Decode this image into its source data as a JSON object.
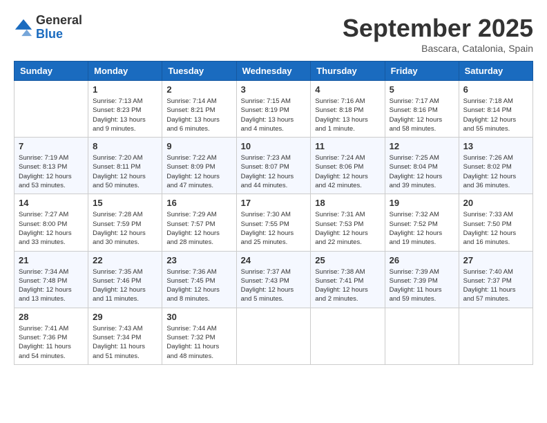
{
  "logo": {
    "general": "General",
    "blue": "Blue"
  },
  "title": "September 2025",
  "subtitle": "Bascara, Catalonia, Spain",
  "days_of_week": [
    "Sunday",
    "Monday",
    "Tuesday",
    "Wednesday",
    "Thursday",
    "Friday",
    "Saturday"
  ],
  "weeks": [
    [
      {
        "day": "",
        "info": ""
      },
      {
        "day": "1",
        "info": "Sunrise: 7:13 AM\nSunset: 8:23 PM\nDaylight: 13 hours\nand 9 minutes."
      },
      {
        "day": "2",
        "info": "Sunrise: 7:14 AM\nSunset: 8:21 PM\nDaylight: 13 hours\nand 6 minutes."
      },
      {
        "day": "3",
        "info": "Sunrise: 7:15 AM\nSunset: 8:19 PM\nDaylight: 13 hours\nand 4 minutes."
      },
      {
        "day": "4",
        "info": "Sunrise: 7:16 AM\nSunset: 8:18 PM\nDaylight: 13 hours\nand 1 minute."
      },
      {
        "day": "5",
        "info": "Sunrise: 7:17 AM\nSunset: 8:16 PM\nDaylight: 12 hours\nand 58 minutes."
      },
      {
        "day": "6",
        "info": "Sunrise: 7:18 AM\nSunset: 8:14 PM\nDaylight: 12 hours\nand 55 minutes."
      }
    ],
    [
      {
        "day": "7",
        "info": "Sunrise: 7:19 AM\nSunset: 8:13 PM\nDaylight: 12 hours\nand 53 minutes."
      },
      {
        "day": "8",
        "info": "Sunrise: 7:20 AM\nSunset: 8:11 PM\nDaylight: 12 hours\nand 50 minutes."
      },
      {
        "day": "9",
        "info": "Sunrise: 7:22 AM\nSunset: 8:09 PM\nDaylight: 12 hours\nand 47 minutes."
      },
      {
        "day": "10",
        "info": "Sunrise: 7:23 AM\nSunset: 8:07 PM\nDaylight: 12 hours\nand 44 minutes."
      },
      {
        "day": "11",
        "info": "Sunrise: 7:24 AM\nSunset: 8:06 PM\nDaylight: 12 hours\nand 42 minutes."
      },
      {
        "day": "12",
        "info": "Sunrise: 7:25 AM\nSunset: 8:04 PM\nDaylight: 12 hours\nand 39 minutes."
      },
      {
        "day": "13",
        "info": "Sunrise: 7:26 AM\nSunset: 8:02 PM\nDaylight: 12 hours\nand 36 minutes."
      }
    ],
    [
      {
        "day": "14",
        "info": "Sunrise: 7:27 AM\nSunset: 8:00 PM\nDaylight: 12 hours\nand 33 minutes."
      },
      {
        "day": "15",
        "info": "Sunrise: 7:28 AM\nSunset: 7:59 PM\nDaylight: 12 hours\nand 30 minutes."
      },
      {
        "day": "16",
        "info": "Sunrise: 7:29 AM\nSunset: 7:57 PM\nDaylight: 12 hours\nand 28 minutes."
      },
      {
        "day": "17",
        "info": "Sunrise: 7:30 AM\nSunset: 7:55 PM\nDaylight: 12 hours\nand 25 minutes."
      },
      {
        "day": "18",
        "info": "Sunrise: 7:31 AM\nSunset: 7:53 PM\nDaylight: 12 hours\nand 22 minutes."
      },
      {
        "day": "19",
        "info": "Sunrise: 7:32 AM\nSunset: 7:52 PM\nDaylight: 12 hours\nand 19 minutes."
      },
      {
        "day": "20",
        "info": "Sunrise: 7:33 AM\nSunset: 7:50 PM\nDaylight: 12 hours\nand 16 minutes."
      }
    ],
    [
      {
        "day": "21",
        "info": "Sunrise: 7:34 AM\nSunset: 7:48 PM\nDaylight: 12 hours\nand 13 minutes."
      },
      {
        "day": "22",
        "info": "Sunrise: 7:35 AM\nSunset: 7:46 PM\nDaylight: 12 hours\nand 11 minutes."
      },
      {
        "day": "23",
        "info": "Sunrise: 7:36 AM\nSunset: 7:45 PM\nDaylight: 12 hours\nand 8 minutes."
      },
      {
        "day": "24",
        "info": "Sunrise: 7:37 AM\nSunset: 7:43 PM\nDaylight: 12 hours\nand 5 minutes."
      },
      {
        "day": "25",
        "info": "Sunrise: 7:38 AM\nSunset: 7:41 PM\nDaylight: 12 hours\nand 2 minutes."
      },
      {
        "day": "26",
        "info": "Sunrise: 7:39 AM\nSunset: 7:39 PM\nDaylight: 11 hours\nand 59 minutes."
      },
      {
        "day": "27",
        "info": "Sunrise: 7:40 AM\nSunset: 7:37 PM\nDaylight: 11 hours\nand 57 minutes."
      }
    ],
    [
      {
        "day": "28",
        "info": "Sunrise: 7:41 AM\nSunset: 7:36 PM\nDaylight: 11 hours\nand 54 minutes."
      },
      {
        "day": "29",
        "info": "Sunrise: 7:43 AM\nSunset: 7:34 PM\nDaylight: 11 hours\nand 51 minutes."
      },
      {
        "day": "30",
        "info": "Sunrise: 7:44 AM\nSunset: 7:32 PM\nDaylight: 11 hours\nand 48 minutes."
      },
      {
        "day": "",
        "info": ""
      },
      {
        "day": "",
        "info": ""
      },
      {
        "day": "",
        "info": ""
      },
      {
        "day": "",
        "info": ""
      }
    ]
  ]
}
